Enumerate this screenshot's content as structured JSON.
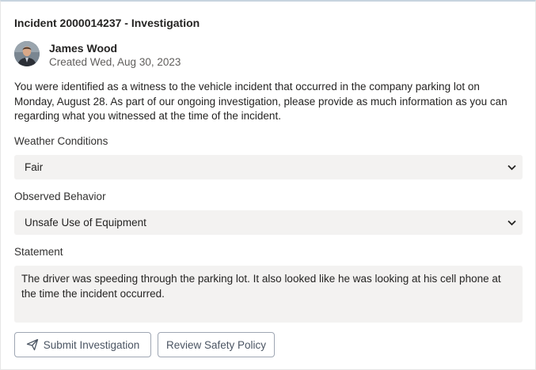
{
  "title": "Incident 2000014237 - Investigation",
  "author": {
    "name": "James Wood",
    "created": "Created Wed, Aug 30, 2023"
  },
  "message": "You were identified as a witness to the vehicle incident that occurred in the company parking lot on Monday, August 28. As part of our ongoing investigation, please provide as much information as you can regarding what you witnessed at the time of the incident.",
  "weather": {
    "label": "Weather Conditions",
    "value": "Fair"
  },
  "behavior": {
    "label": "Observed Behavior",
    "value": "Unsafe Use of Equipment"
  },
  "statement": {
    "label": "Statement",
    "value": "The driver was speeding through the parking lot. It also looked like he was looking at his cell phone at the time the incident occurred."
  },
  "actions": {
    "submit_label": "Submit Investigation",
    "submit_icon": "send-icon",
    "review_label": "Review Safety Policy"
  },
  "colors": {
    "field_bg": "#f3f2f1",
    "button_border": "#9ea6b3",
    "header_border": "#c7d4df"
  }
}
